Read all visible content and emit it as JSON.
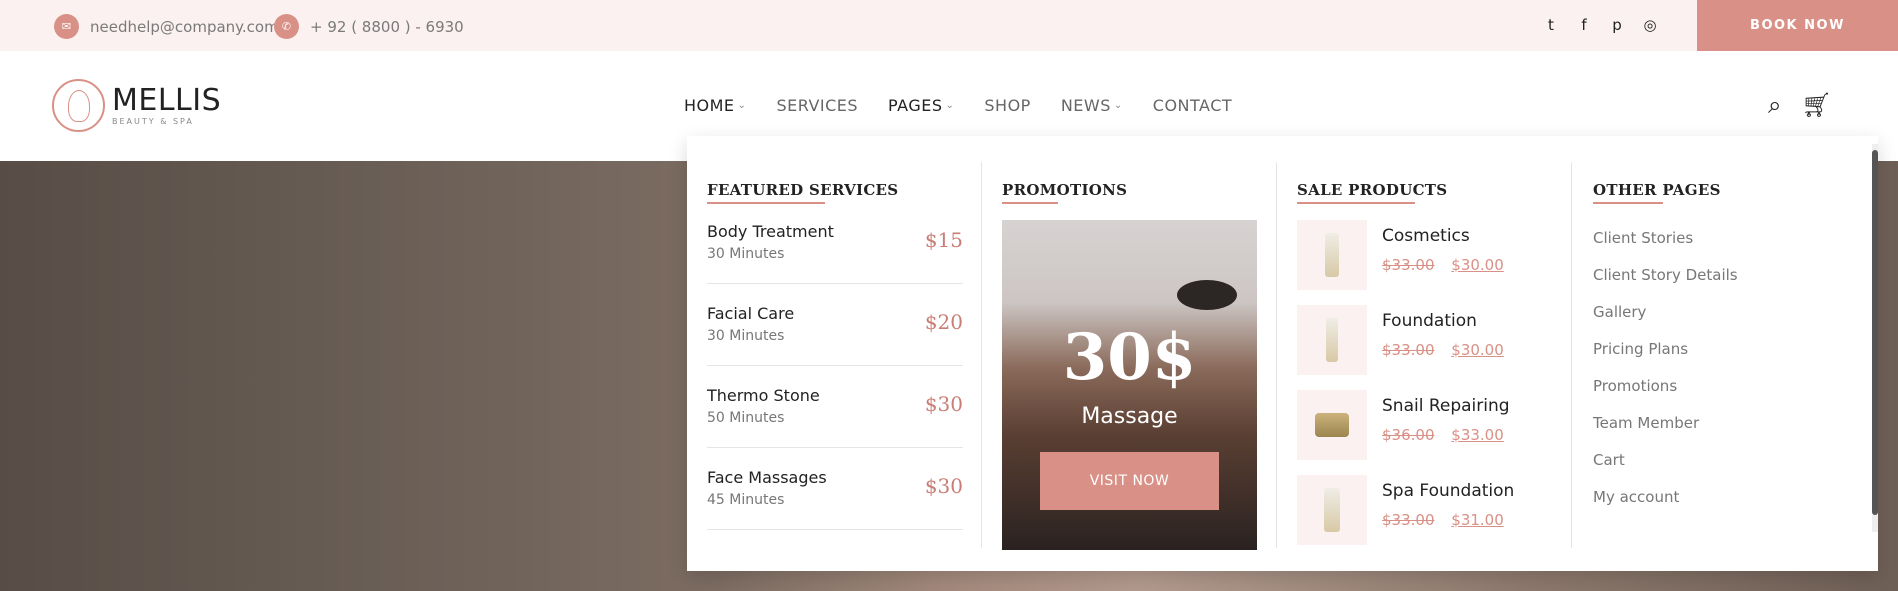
{
  "topbar": {
    "email": "needhelp@company.com",
    "phone": "+ 92 ( 8800 ) - 6930",
    "socials": [
      "twitter-icon",
      "facebook-icon",
      "pinterest-icon",
      "instagram-icon"
    ],
    "book_label": "BOOK NOW"
  },
  "brand": {
    "name": "MELLIS",
    "tagline": "BEAUTY & SPA"
  },
  "nav": {
    "items": [
      {
        "label": "HOME"
      },
      {
        "label": "SERVICES"
      },
      {
        "label": "PAGES"
      },
      {
        "label": "SHOP"
      },
      {
        "label": "NEWS"
      },
      {
        "label": "CONTACT"
      }
    ]
  },
  "mega": {
    "featured": {
      "title": "FEATURED SERVICES",
      "items": [
        {
          "name": "Body Treatment",
          "duration": "30 Minutes",
          "price": "$15"
        },
        {
          "name": "Facial Care",
          "duration": "30 Minutes",
          "price": "$20"
        },
        {
          "name": "Thermo Stone",
          "duration": "50 Minutes",
          "price": "$30"
        },
        {
          "name": "Face Massages",
          "duration": "45 Minutes",
          "price": "$30"
        }
      ]
    },
    "promotions": {
      "title": "PROMOTIONS",
      "headline": "30$",
      "subline": "Massage",
      "cta": "VISIT NOW"
    },
    "sale": {
      "title": "SALE PRODUCTS",
      "items": [
        {
          "name": "Cosmetics",
          "old_price": "$33.00",
          "new_price": "$30.00"
        },
        {
          "name": "Foundation",
          "old_price": "$33.00",
          "new_price": "$30.00"
        },
        {
          "name": "Snail Repairing",
          "old_price": "$36.00",
          "new_price": "$33.00"
        },
        {
          "name": "Spa Foundation",
          "old_price": "$33.00",
          "new_price": "$31.00"
        }
      ]
    },
    "other": {
      "title": "OTHER PAGES",
      "links": [
        "Client Stories",
        "Client Story Details",
        "Gallery",
        "Pricing Plans",
        "Promotions",
        "Team Member",
        "Cart",
        "My account"
      ]
    }
  },
  "colors": {
    "accent": "#d99086",
    "topbar_bg": "#fbf1f0"
  }
}
